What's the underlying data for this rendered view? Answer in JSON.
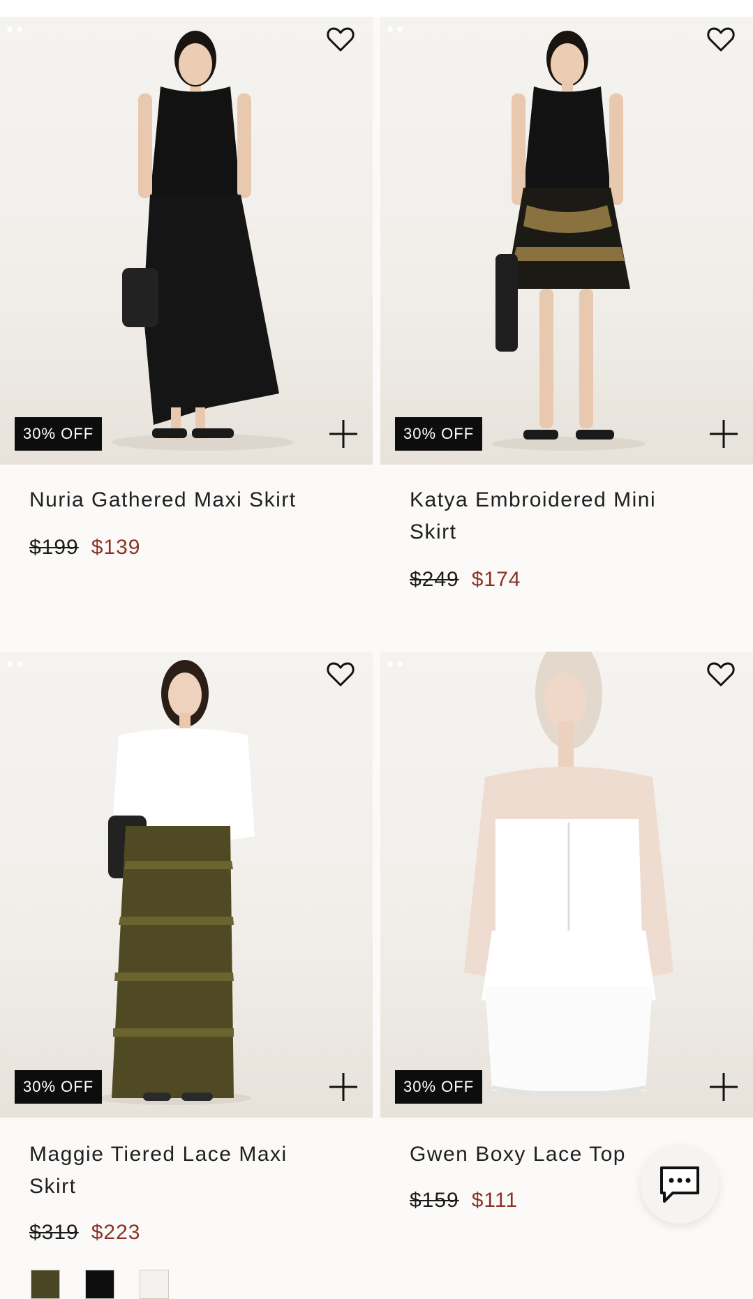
{
  "products": [
    {
      "title": "Nuria Gathered Maxi Skirt",
      "badge": "30% OFF",
      "old_price": "$199",
      "new_price": "$139"
    },
    {
      "title": "Katya Embroidered Mini Skirt",
      "badge": "30% OFF",
      "old_price": "$249",
      "new_price": "$174"
    },
    {
      "title": "Maggie Tiered Lace Maxi Skirt",
      "badge": "30% OFF",
      "old_price": "$319",
      "new_price": "$223",
      "swatches": [
        {
          "color": "#4a4522"
        },
        {
          "color": "#0e0e0e"
        },
        {
          "color": "#f4f2ee"
        }
      ]
    },
    {
      "title": "Gwen Boxy Lace Top",
      "badge": "30% OFF",
      "old_price": "$159",
      "new_price": "$111"
    }
  ],
  "icons": {
    "wishlist": "heart-icon",
    "add": "plus-icon",
    "chat": "chat-bubble-icon"
  },
  "colors": {
    "sale_price": "#8b3226",
    "badge_bg": "#0d0d0d"
  }
}
